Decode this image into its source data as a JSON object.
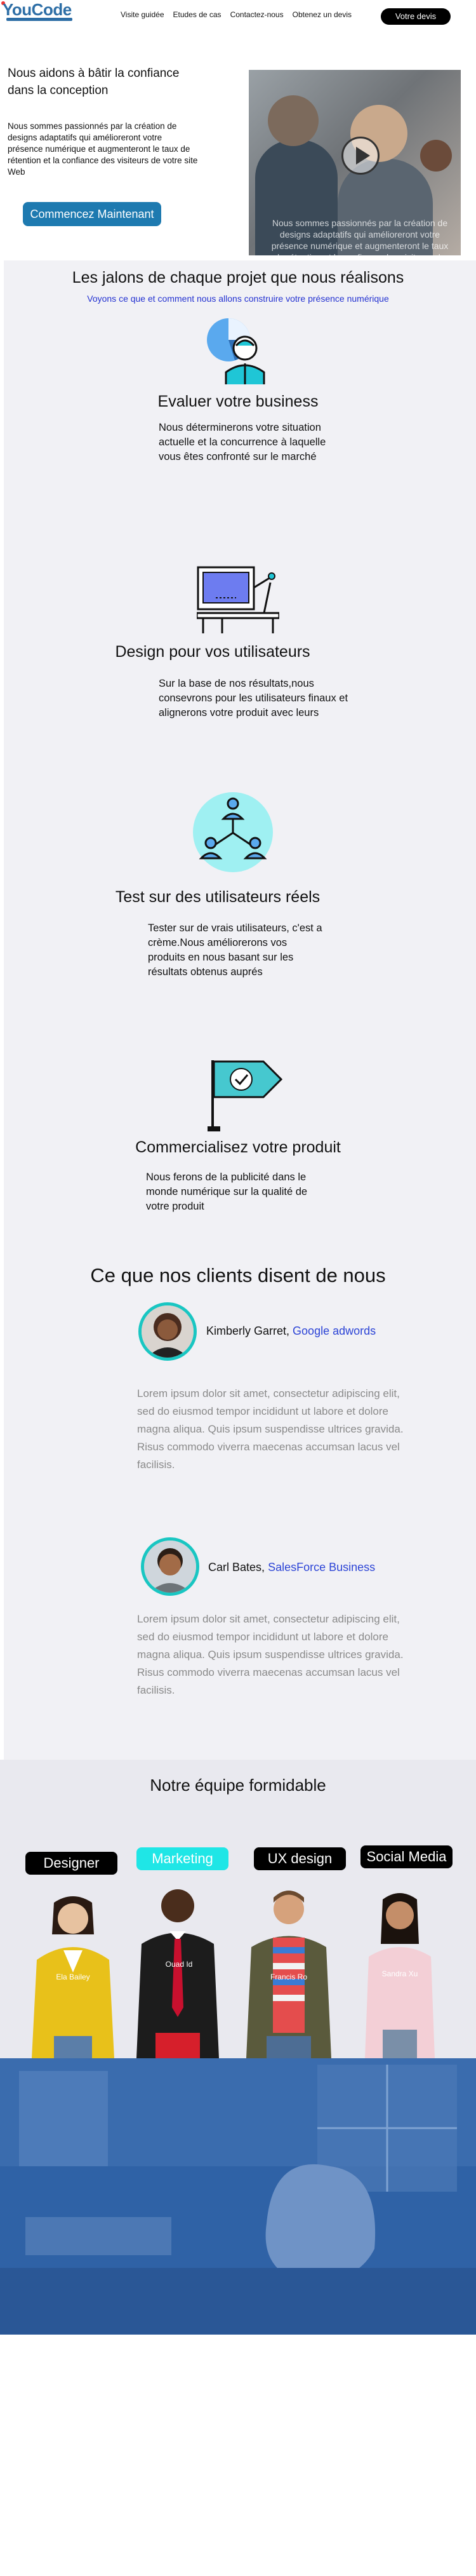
{
  "nav": {
    "logo": "YouCode",
    "links": [
      "Visite guidée",
      "Etudes de cas",
      "Contactez-nous",
      "Obtenez un devis"
    ],
    "cta": "Votre devis"
  },
  "hero": {
    "title": "Nous aidons à bâtir la confiance dans la conception",
    "text": "Nous sommes passionnés par la création de designs adaptatifs qui amélioreront votre présence numérique et augmenteront le taux de rétention et la confiance des visiteurs de votre site Web",
    "button": "Commencez Maintenant",
    "caption": "Nous sommes passionnés par la création de designs adaptatifs qui amélioreront votre présence numérique et augmenteront le taux de rétention et la confiance des visiteurs de votre site Web avec les clients. Nous amènerons vos clients à vous faire confiance."
  },
  "milestones": {
    "title": "Les jalons de chaque projet que nous réalisons",
    "subtitle": "Voyons ce que et comment nous allons construire votre présence numérique",
    "steps": [
      {
        "title": "Evaluer votre business",
        "text": "Nous déterminerons votre situation actuelle et la concurrence à laquelle vous êtes confronté sur le marché",
        "icon": "analytics-person-icon"
      },
      {
        "title": "Design pour vos utilisateurs",
        "text": "Sur la base de nos résultats,nous consevrons pour les utilisateurs finaux et alignerons votre produit avec leurs",
        "icon": "design-desk-icon"
      },
      {
        "title": "Test sur des utilisateurs réels",
        "text": "Tester sur de vrais utilisateurs, c'est a crème.Nous améliorerons vos produits en nous basant sur les résultats obtenus auprés",
        "icon": "user-network-icon"
      },
      {
        "title": "Commercialisez votre produit",
        "text": "Nous ferons de la publicité dans le monde numérique sur la qualité de votre produit",
        "icon": "flag-check-icon"
      }
    ]
  },
  "testimonials": {
    "title": "Ce que nos clients disent de nous",
    "items": [
      {
        "name": "Kimberly Garret,",
        "company": "Google adwords",
        "body": "Lorem ipsum dolor sit amet, consectetur adipiscing elit, sed do eiusmod tempor incididunt ut labore et dolore magna aliqua. Quis ipsum suspendisse ultrices gravida. Risus commodo viverra maecenas accumsan lacus vel facilisis."
      },
      {
        "name": "Carl Bates,",
        "company": "SalesForce Business",
        "body": "Lorem ipsum dolor sit amet, consectetur adipiscing elit, sed do eiusmod tempor incididunt ut labore et dolore magna aliqua. Quis ipsum suspendisse ultrices gravida. Risus commodo viverra maecenas accumsan lacus vel facilisis."
      }
    ]
  },
  "team": {
    "title": "Notre équipe formidable",
    "members": [
      {
        "role": "Designer",
        "name": "Ela Bailey"
      },
      {
        "role": "Marketing",
        "name": "Ouad Id"
      },
      {
        "role": "UX design",
        "name": "Francis Ro"
      },
      {
        "role": "Social Media",
        "name": "Sandra Xu"
      }
    ]
  },
  "colors": {
    "accent": "#1e7ab0",
    "teal": "#19c6c2",
    "link": "#2432d1",
    "cyan_bubble": "#1fe6e6"
  }
}
